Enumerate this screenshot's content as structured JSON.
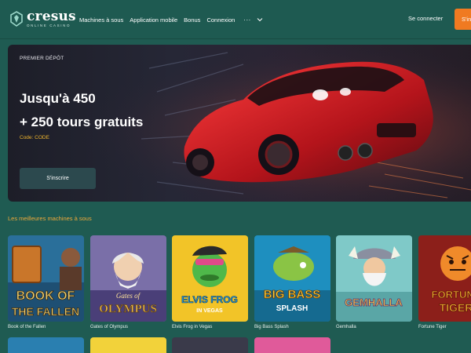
{
  "header": {
    "logo_word": "cresus",
    "logo_sub": "ONLINE CASINO",
    "nav": [
      "Machines à sous",
      "Application mobile",
      "Bonus",
      "Connexion"
    ],
    "more": "···",
    "login": "Se connecter",
    "signup": "S'inscrire"
  },
  "hero": {
    "eyebrow": "PREMIER DÉPÔT",
    "line1": "Jusqu'à 450",
    "line2": "+ 250 tours gratuits",
    "code": "Code: CODE",
    "button": "S'inscrire"
  },
  "section": {
    "title": "Les meilleures machines à sous"
  },
  "games": [
    {
      "name": "Book of the Fallen",
      "art_text": [
        "BOOK OF",
        "THE FALLEN"
      ],
      "colors": [
        "#2a6f9a",
        "#c9762a"
      ]
    },
    {
      "name": "Gates of Olympus",
      "art_text": [
        "Gates of",
        "OLYMPUS"
      ],
      "colors": [
        "#7a6fa8",
        "#e0b04a"
      ]
    },
    {
      "name": "Elvis Frog in Vegas",
      "art_text": [
        "ELVIS FROG",
        "IN VEGAS"
      ],
      "colors": [
        "#f2c428",
        "#4fb84a"
      ]
    },
    {
      "name": "Big Bass Splash",
      "art_text": [
        "BIG BASS",
        "SPLASH"
      ],
      "colors": [
        "#1e8fbf",
        "#8ac445"
      ]
    },
    {
      "name": "Gemhalla",
      "art_text": [
        "GEMHALLA"
      ],
      "colors": [
        "#7fc9c8",
        "#7a4a9a"
      ]
    },
    {
      "name": "Fortune Tiger",
      "art_text": [
        "FORTUNE",
        "TIGER"
      ],
      "colors": [
        "#8c1f1a",
        "#f0b430"
      ]
    }
  ],
  "colors": {
    "background": "#1f5b52",
    "accent": "#f07a21",
    "section_title": "#f0a93a",
    "promo_code": "#f0b62d"
  }
}
